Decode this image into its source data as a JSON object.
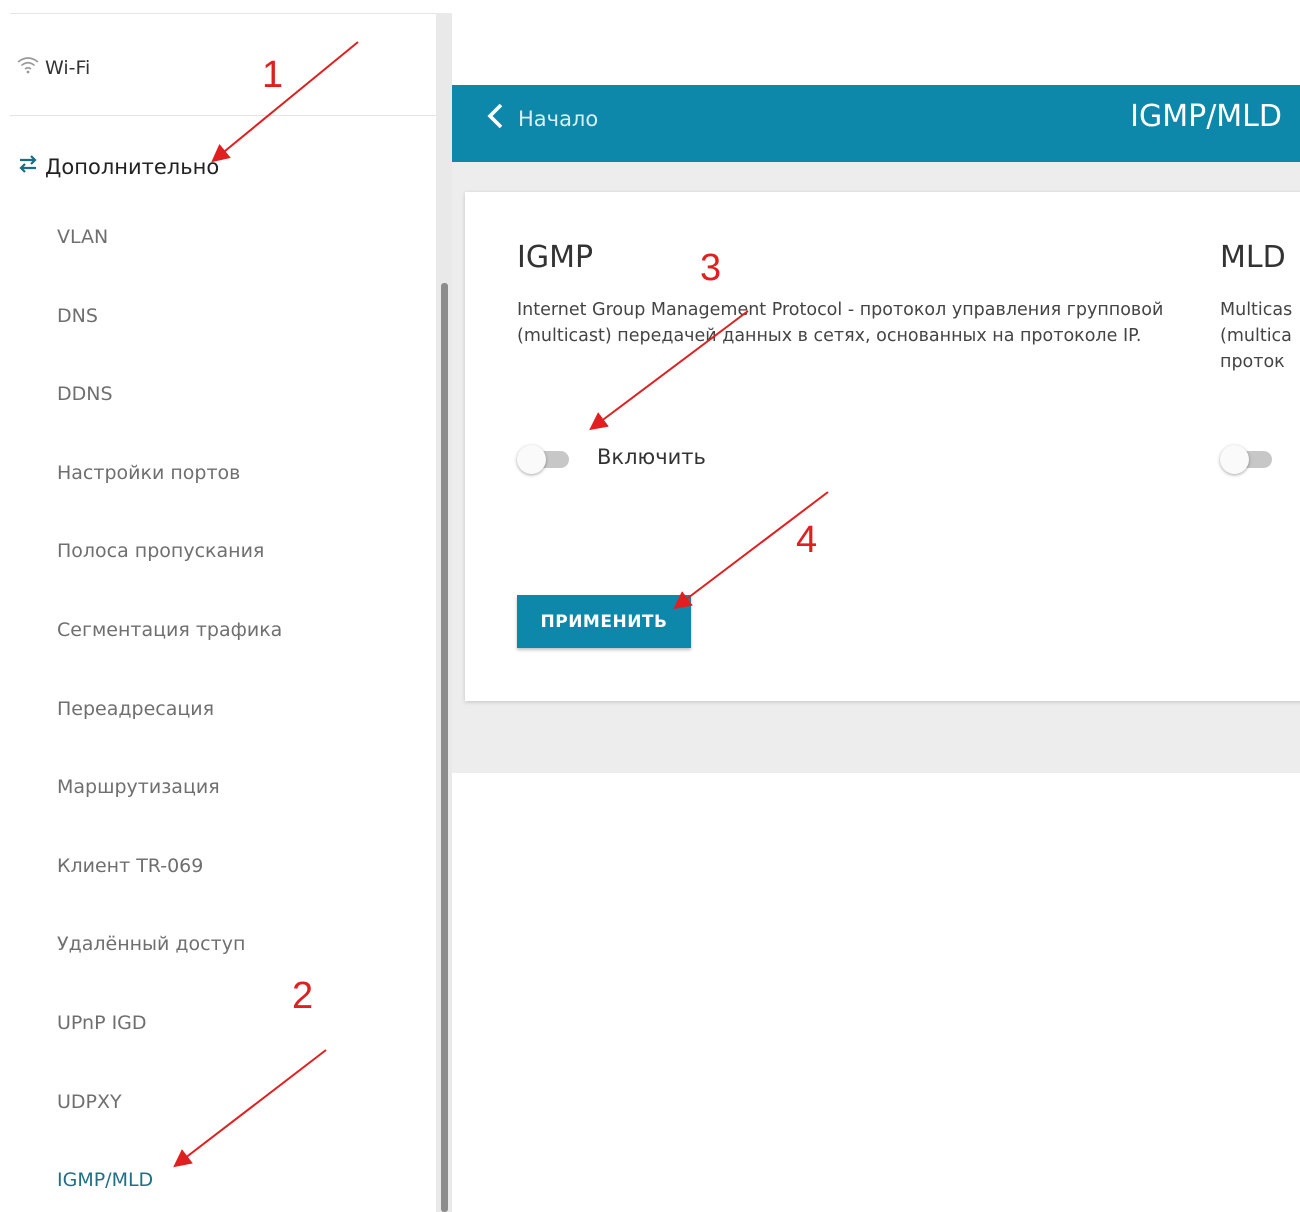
{
  "sidebar": {
    "wifi_label": "Wi-Fi",
    "section_label": "Дополнительно",
    "items": [
      {
        "label": "VLAN"
      },
      {
        "label": "DNS"
      },
      {
        "label": "DDNS"
      },
      {
        "label": "Настройки портов"
      },
      {
        "label": "Полоса пропускания"
      },
      {
        "label": "Сегментация трафика"
      },
      {
        "label": "Переадресация"
      },
      {
        "label": "Маршрутизация"
      },
      {
        "label": "Клиент TR-069"
      },
      {
        "label": "Удалённый доступ"
      },
      {
        "label": "UPnP IGD"
      },
      {
        "label": "UDPXY"
      },
      {
        "label": "IGMP/MLD",
        "active": true
      }
    ]
  },
  "header": {
    "back_label": "Начало",
    "title": "IGMP/MLD"
  },
  "igmp": {
    "title": "IGMP",
    "description": "Internet Group Management Protocol - протокол управления групповой (multicast) передачей данных в сетях, основанных на протоколе IP.",
    "toggle_label": "Включить",
    "enabled": false
  },
  "mld": {
    "title": "MLD",
    "description_fragment": [
      "Multicas",
      "(multica",
      "проток"
    ],
    "enabled": false
  },
  "apply_label": "ПРИМЕНИТЬ",
  "annotations": [
    "1",
    "2",
    "3",
    "4"
  ],
  "colors": {
    "accent": "#0d88aa",
    "annotation": "#e02020",
    "active_nav": "#1f6f87"
  }
}
